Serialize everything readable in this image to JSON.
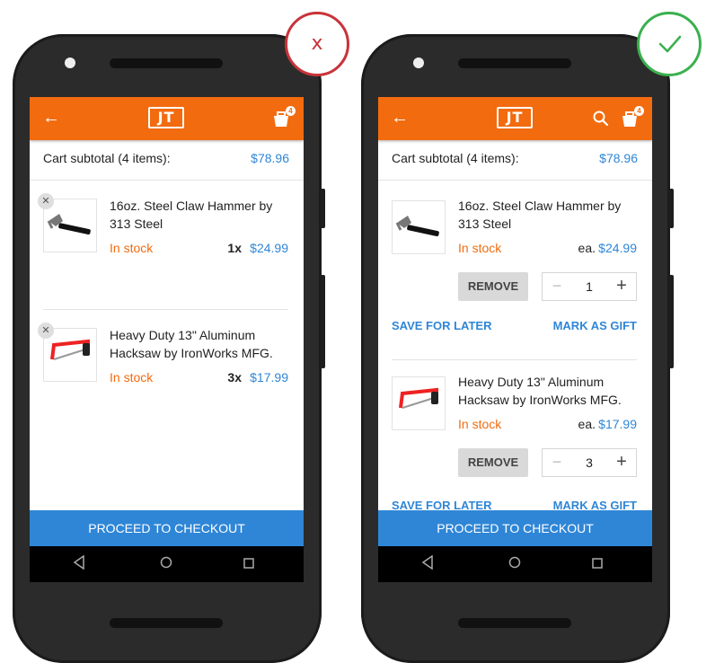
{
  "badges": {
    "wrong": "x",
    "right": "✓"
  },
  "colors": {
    "appbar": "#f26b0f",
    "accent_blue": "#2f86d6",
    "in_stock": "#f26b0f",
    "wrong": "#c8333a",
    "right": "#3ab04e"
  },
  "app": {
    "logo_text": "JT",
    "cart_count": "4"
  },
  "subtotal": {
    "label": "Cart subtotal (4 items):",
    "value": "$78.96"
  },
  "left_items": [
    {
      "name": "16oz. Steel Claw Hammer by 313 Steel",
      "stock": "In stock",
      "qty": "1x",
      "price": "$24.99",
      "icon": "hammer-image"
    },
    {
      "name": "Heavy Duty 13\" Aluminum Hacksaw by IronWorks MFG.",
      "stock": "In stock",
      "qty": "3x",
      "price": "$17.99",
      "icon": "hacksaw-image"
    }
  ],
  "right_items": [
    {
      "name": "16oz. Steel Claw Hammer by 313 Steel",
      "stock": "In stock",
      "ea": "ea.",
      "price": "$24.99",
      "remove": "REMOVE",
      "quantity": "1",
      "save": "SAVE FOR LATER",
      "gift": "MARK AS GIFT"
    },
    {
      "name": "Heavy Duty 13\" Aluminum Hacksaw by IronWorks MFG.",
      "stock": "In stock",
      "ea": "ea.",
      "price": "$17.99",
      "remove": "REMOVE",
      "quantity": "3",
      "save": "SAVE FOR LATER",
      "gift": "MARK AS GIFT"
    }
  ],
  "checkout": {
    "label": "PROCEED TO CHECKOUT"
  },
  "stepper": {
    "minus": "−",
    "plus": "+"
  },
  "icons": {
    "back": "←",
    "remove": "✕"
  }
}
